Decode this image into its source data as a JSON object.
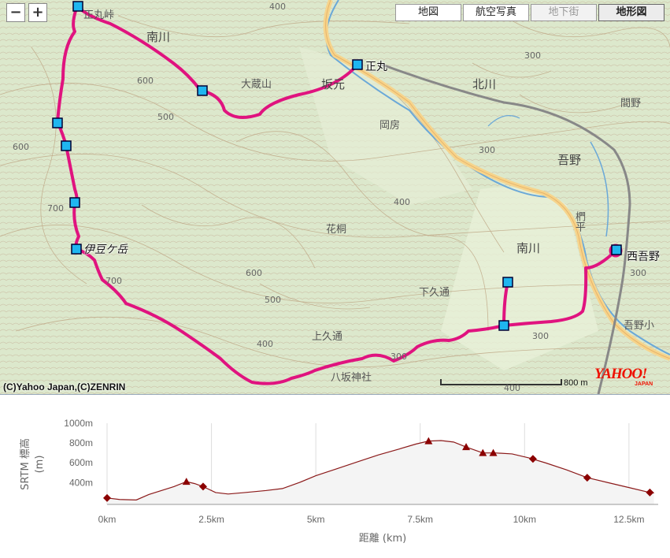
{
  "map": {
    "zoom_in": "+",
    "zoom_out": "−",
    "types": [
      {
        "label": "地図",
        "state": "normal"
      },
      {
        "label": "航空写真",
        "state": "normal"
      },
      {
        "label": "地下街",
        "state": "disabled"
      },
      {
        "label": "地形図",
        "state": "active"
      }
    ],
    "copyright": "(C)Yahoo Japan,(C)ZENRIN",
    "scale_label": "800 m",
    "logo": "YAHOO!",
    "logo_sub": "JAPAN",
    "route_color": "#e0137f",
    "marker_color": "#1fb6f0",
    "places": {
      "shomaru": "正丸",
      "nishiagano": "西吾野",
      "izugatake": "伊豆ケ岳",
      "shomaru_toge": "正丸峠",
      "minamikawa_1": "南川",
      "minamikawa_2": "南川",
      "kitakawa": "北川",
      "agano": "吾野",
      "okuramiyama": "大蔵山",
      "sakamoto": "坂元",
      "okabo": "岡房",
      "hanagiri": "花桐",
      "shimokudo": "下久通",
      "kamikudo": "上久通",
      "mama": "間野",
      "kabira": "椚平",
      "yasaka": "八坂神社",
      "agano_school": "吾野小"
    },
    "contours": [
      "400",
      "600",
      "500",
      "600",
      "700",
      "700",
      "600",
      "500",
      "400",
      "400",
      "300",
      "300",
      "300",
      "400",
      "300",
      "300"
    ]
  },
  "chart_data": {
    "type": "area",
    "xlabel": "距離 (km)",
    "ylabel": "SRTM 標高",
    "ylabel_unit": "(m)",
    "xlim": [
      0,
      13.2
    ],
    "ylim": [
      180,
      1000
    ],
    "x_ticks": [
      "0km",
      "2.5km",
      "5km",
      "7.5km",
      "10km",
      "12.5km"
    ],
    "x_tick_values": [
      0,
      2.5,
      5,
      7.5,
      10,
      12.5
    ],
    "y_ticks": [
      "1000m",
      "800m",
      "600m",
      "400m"
    ],
    "y_tick_values": [
      1000,
      800,
      600,
      400
    ],
    "line_color": "#8b1a1a",
    "fill_color": "#f4f4f4",
    "profile": [
      [
        0,
        245
      ],
      [
        0.3,
        230
      ],
      [
        0.7,
        225
      ],
      [
        1.0,
        280
      ],
      [
        1.3,
        320
      ],
      [
        1.6,
        360
      ],
      [
        1.9,
        410
      ],
      [
        2.1,
        390
      ],
      [
        2.3,
        360
      ],
      [
        2.6,
        300
      ],
      [
        2.9,
        285
      ],
      [
        3.3,
        300
      ],
      [
        3.8,
        320
      ],
      [
        4.2,
        340
      ],
      [
        4.6,
        400
      ],
      [
        5.0,
        470
      ],
      [
        5.5,
        540
      ],
      [
        6.0,
        610
      ],
      [
        6.5,
        680
      ],
      [
        7.0,
        740
      ],
      [
        7.4,
        790
      ],
      [
        7.7,
        820
      ],
      [
        8.0,
        825
      ],
      [
        8.3,
        810
      ],
      [
        8.6,
        760
      ],
      [
        9.0,
        700
      ],
      [
        9.3,
        700
      ],
      [
        9.7,
        690
      ],
      [
        10.1,
        650
      ],
      [
        10.5,
        600
      ],
      [
        11.0,
        530
      ],
      [
        11.5,
        450
      ],
      [
        12.0,
        400
      ],
      [
        12.5,
        350
      ],
      [
        13.0,
        300
      ],
      [
        13.1,
        295
      ]
    ],
    "markers": [
      {
        "x": 0.0,
        "y": 245,
        "shape": "diamond"
      },
      {
        "x": 1.9,
        "y": 410,
        "shape": "triangle"
      },
      {
        "x": 2.3,
        "y": 360,
        "shape": "diamond"
      },
      {
        "x": 7.7,
        "y": 820,
        "shape": "triangle"
      },
      {
        "x": 8.6,
        "y": 760,
        "shape": "triangle"
      },
      {
        "x": 9.0,
        "y": 700,
        "shape": "triangle"
      },
      {
        "x": 9.25,
        "y": 700,
        "shape": "triangle"
      },
      {
        "x": 10.2,
        "y": 640,
        "shape": "diamond"
      },
      {
        "x": 11.5,
        "y": 450,
        "shape": "diamond"
      },
      {
        "x": 13.0,
        "y": 300,
        "shape": "diamond"
      }
    ]
  }
}
